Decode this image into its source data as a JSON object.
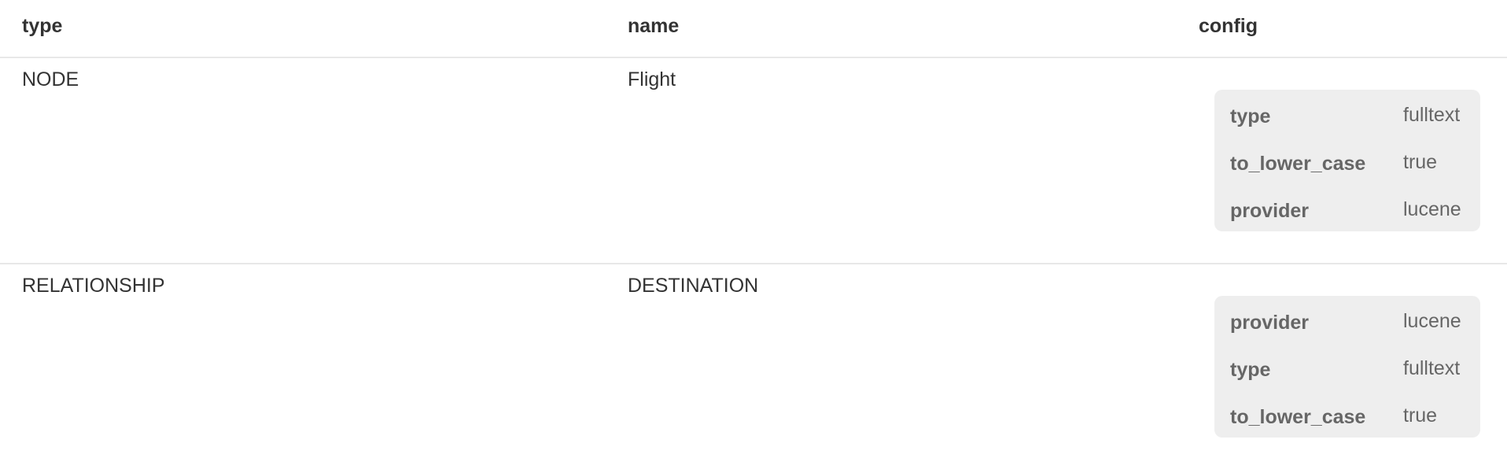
{
  "table": {
    "columns": [
      "type",
      "name",
      "config"
    ],
    "rows": [
      {
        "type": "NODE",
        "name": "Flight",
        "config": [
          {
            "key": "type",
            "value": "fulltext"
          },
          {
            "key": "to_lower_case",
            "value": "true"
          },
          {
            "key": "provider",
            "value": "lucene"
          }
        ]
      },
      {
        "type": "RELATIONSHIP",
        "name": "DESTINATION",
        "config": [
          {
            "key": "provider",
            "value": "lucene"
          },
          {
            "key": "type",
            "value": "fulltext"
          },
          {
            "key": "to_lower_case",
            "value": "true"
          }
        ]
      }
    ]
  }
}
